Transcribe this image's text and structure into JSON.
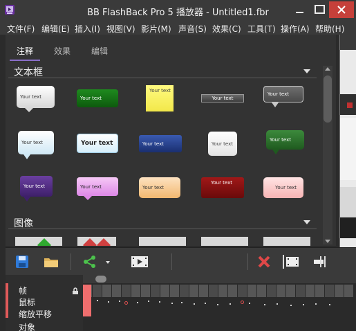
{
  "window": {
    "title": "BB FlashBack Pro 5 播放器 - Untitled1.fbr",
    "controls": [
      "minimize",
      "maximize",
      "close"
    ]
  },
  "menu": [
    "文件(F)",
    "编辑(E)",
    "插入(I)",
    "视图(V)",
    "影片(M)",
    "声音(S)",
    "效果(C)",
    "工具(T)",
    "操作(A)",
    "帮助(H)"
  ],
  "tabs": [
    {
      "label": "注释",
      "active": true
    },
    {
      "label": "效果",
      "active": false
    },
    {
      "label": "编辑",
      "active": false
    }
  ],
  "sections": {
    "textbox": "文本框",
    "image": "图像"
  },
  "callouts": [
    {
      "label": "Your text",
      "style": "white-speech"
    },
    {
      "label": "Your text",
      "style": "green-rounded"
    },
    {
      "label": "Your text",
      "style": "yellow-sticky"
    },
    {
      "label": "Your text",
      "style": "gray-bar"
    },
    {
      "label": "Your text",
      "style": "gray-speech"
    },
    {
      "label": "Your text",
      "style": "light-blue-speech"
    },
    {
      "label": "Your text",
      "style": "light-blue-rounded"
    },
    {
      "label": "Your text",
      "style": "blue-rect"
    },
    {
      "label": "Your text",
      "style": "white-rounded"
    },
    {
      "label": "Your text",
      "style": "green-speech"
    },
    {
      "label": "Your text",
      "style": "purple-speech"
    },
    {
      "label": "Your text",
      "style": "pink-speech"
    },
    {
      "label": "Your text",
      "style": "peach-rounded"
    },
    {
      "label": "Your text",
      "style": "red-rect"
    },
    {
      "label": "Your text",
      "style": "pink-rounded"
    }
  ],
  "toolbar": {
    "buttons": [
      "save-icon",
      "open-folder-icon",
      "share-icon",
      "dropdown-arrow-icon",
      "film-play-icon",
      "delete-icon",
      "film-split-icon",
      "trim-icon"
    ]
  },
  "timeline": {
    "tracks": [
      "帧",
      "鼠标",
      "缩放平移",
      "对象"
    ]
  },
  "colors": {
    "accent_tab": "#8a6fc9",
    "close_button": "#c6403a",
    "timeline_marker": "#e05a5a"
  }
}
